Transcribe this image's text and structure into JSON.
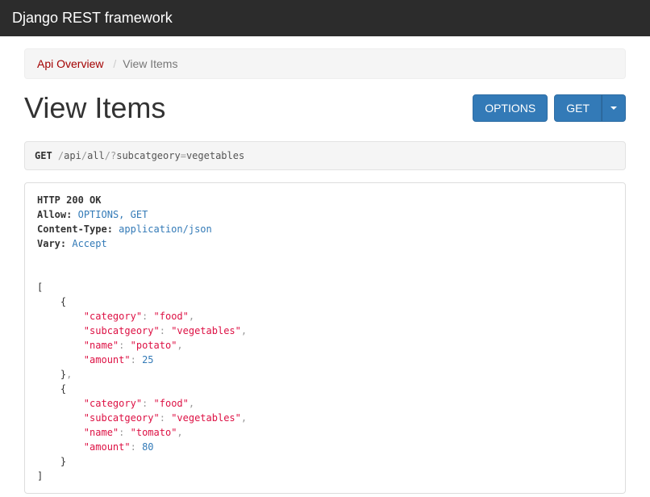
{
  "navbar": {
    "brand": "Django REST framework"
  },
  "breadcrumb": {
    "root": {
      "label": "Api Overview"
    },
    "current": {
      "label": "View Items"
    }
  },
  "page": {
    "title": "View Items"
  },
  "buttons": {
    "options": "OPTIONS",
    "get": "GET"
  },
  "request": {
    "method": "GET",
    "path_p1": "/",
    "path_s1": "api",
    "path_p2": "/",
    "path_s2": "all",
    "path_p3": "/",
    "path_q": "?",
    "path_param": "subcatgeory",
    "path_eq": "=",
    "path_val": "vegetables"
  },
  "response": {
    "status": "HTTP 200 OK",
    "headers": {
      "allow_k": "Allow:",
      "allow_v": "OPTIONS, GET",
      "ctype_k": "Content-Type:",
      "ctype_v": "application/json",
      "vary_k": "Vary:",
      "vary_v": "Accept"
    },
    "body": [
      {
        "category": "food",
        "subcatgeory": "vegetables",
        "name": "potato",
        "amount": 25
      },
      {
        "category": "food",
        "subcatgeory": "vegetables",
        "name": "tomato",
        "amount": 80
      }
    ],
    "keys": {
      "category": "\"category\"",
      "subcatgeory": "\"subcatgeory\"",
      "name": "\"name\"",
      "amount": "\"amount\""
    },
    "vals": {
      "r0_category": "\"food\"",
      "r0_subcatgeory": "\"vegetables\"",
      "r0_name": "\"potato\"",
      "r0_amount": "25",
      "r1_category": "\"food\"",
      "r1_subcatgeory": "\"vegetables\"",
      "r1_name": "\"tomato\"",
      "r1_amount": "80"
    }
  }
}
